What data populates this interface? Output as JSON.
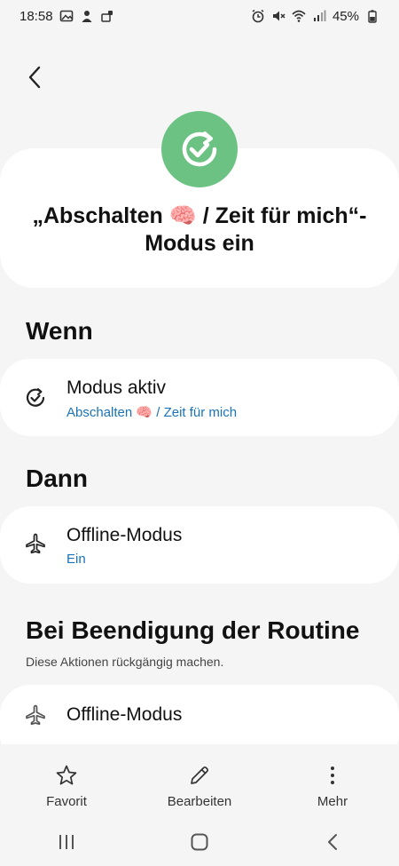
{
  "status_bar": {
    "time": "18:58",
    "battery": "45%",
    "icons_left": [
      "image-icon",
      "person-icon",
      "notification-icon"
    ],
    "icons_right": [
      "alarm-icon",
      "mute-icon",
      "wifi-icon",
      "signal-icon",
      "battery-icon"
    ]
  },
  "header": {
    "title": "„Abschalten 🧠 / Zeit für mich“-Modus ein",
    "icon": "routine-check-icon",
    "icon_color": "#6cc283"
  },
  "sections": {
    "wenn": {
      "title": "Wenn",
      "item": {
        "title": "Modus aktiv",
        "subtitle": "Abschalten 🧠 / Zeit für mich",
        "icon": "mode-check-icon"
      }
    },
    "dann": {
      "title": "Dann",
      "item": {
        "title": "Offline-Modus",
        "subtitle": "Ein",
        "icon": "airplane-icon"
      }
    },
    "ende": {
      "title": "Bei Beendigung der Routine",
      "subtitle": "Diese Aktionen rückgängig machen.",
      "item": {
        "title": "Offline-Modus",
        "icon": "airplane-icon"
      }
    }
  },
  "toolbar": {
    "favorite_label": "Favorit",
    "edit_label": "Bearbeiten",
    "more_label": "Mehr"
  },
  "colors": {
    "accent_link": "#1b73b8",
    "background": "#f5f5f5",
    "card": "#ffffff"
  }
}
